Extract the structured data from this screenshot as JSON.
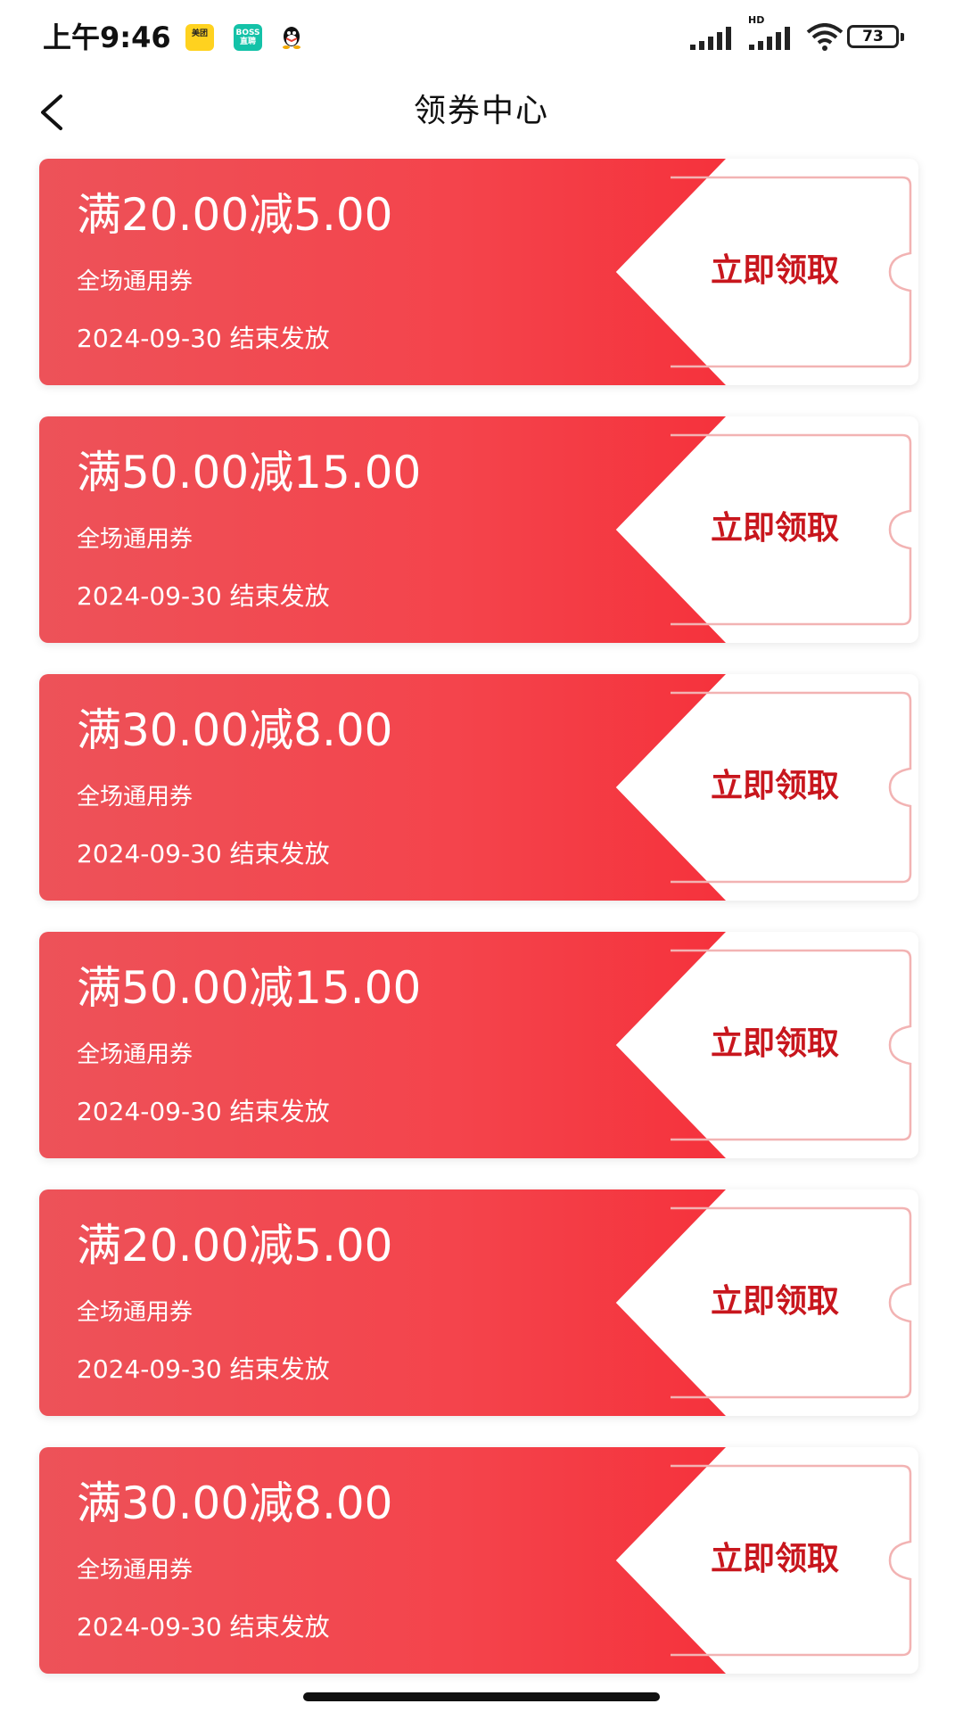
{
  "status_bar": {
    "time": "上午9:46",
    "meituan_icon_text": "美团",
    "boss_icon_text": "BOSS直聘",
    "hd_label": "HD",
    "battery_level": "73"
  },
  "header": {
    "title": "领券中心"
  },
  "coupons": [
    {
      "amount": "满20.00减5.00",
      "scope": "全场通用券",
      "expiry": "2024-09-30 结束发放",
      "claim_label": "立即领取"
    },
    {
      "amount": "满50.00减15.00",
      "scope": "全场通用券",
      "expiry": "2024-09-30 结束发放",
      "claim_label": "立即领取"
    },
    {
      "amount": "满30.00减8.00",
      "scope": "全场通用券",
      "expiry": "2024-09-30 结束发放",
      "claim_label": "立即领取"
    },
    {
      "amount": "满50.00减15.00",
      "scope": "全场通用券",
      "expiry": "2024-09-30 结束发放",
      "claim_label": "立即领取"
    },
    {
      "amount": "满20.00减5.00",
      "scope": "全场通用券",
      "expiry": "2024-09-30 结束发放",
      "claim_label": "立即领取"
    },
    {
      "amount": "满30.00减8.00",
      "scope": "全场通用券",
      "expiry": "2024-09-30 结束发放",
      "claim_label": "立即领取"
    }
  ],
  "colors": {
    "coupon_red": "#f4444c",
    "claim_text": "#c8161d",
    "outline_pink": "#f2b3b3"
  }
}
